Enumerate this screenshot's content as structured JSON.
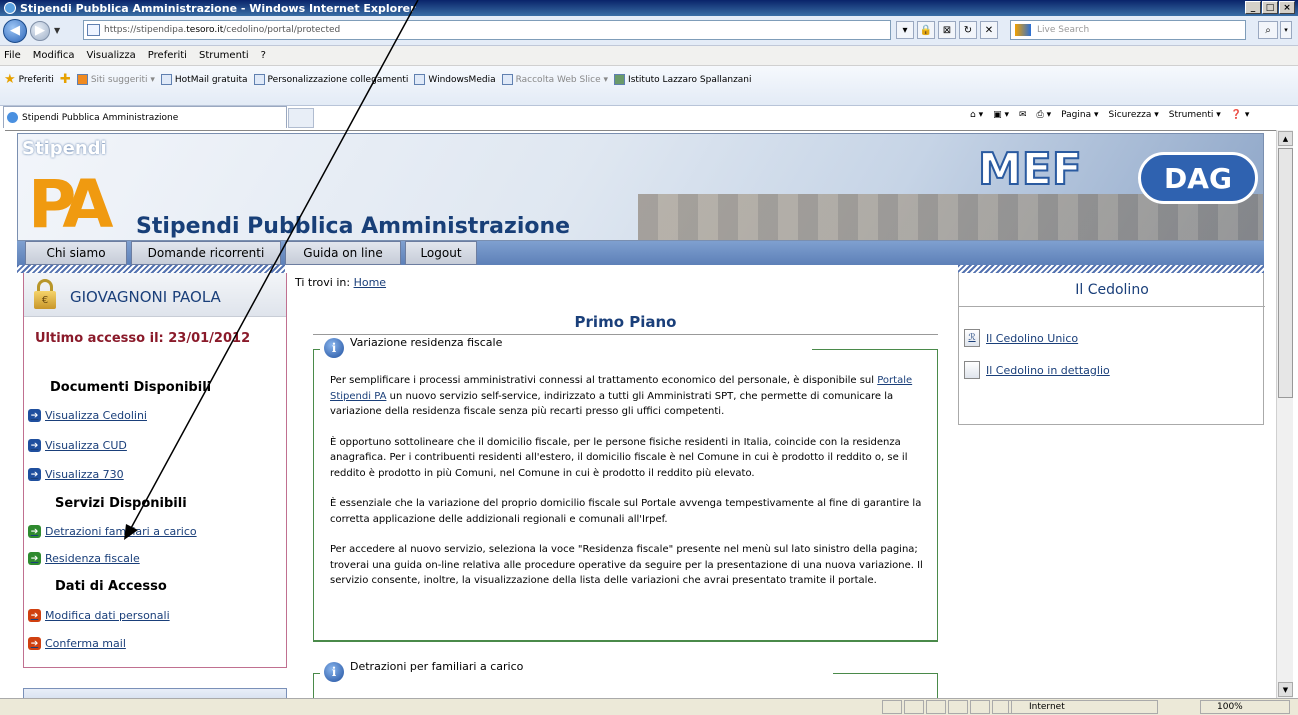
{
  "window": {
    "title": "Stipendi Pubblica Amministrazione - Windows Internet Explorer"
  },
  "address": {
    "url_prefix": "https://stipendipa.",
    "url_domain": "tesoro.it",
    "url_suffix": "/cedolino/portal/protected",
    "search_placeholder": "Live Search"
  },
  "menu": [
    "File",
    "Modifica",
    "Visualizza",
    "Preferiti",
    "Strumenti",
    "?"
  ],
  "favorites": {
    "label": "Preferiti",
    "items": [
      "Siti suggeriti ▾",
      "HotMail gratuita",
      "Personalizzazione collegamenti",
      "WindowsMedia",
      "Raccolta Web Slice ▾",
      "Istituto Lazzaro Spallanzani"
    ]
  },
  "tab": {
    "title": "Stipendi Pubblica Amministrazione"
  },
  "commandbar": [
    "Pagina ▾",
    "Sicurezza ▾",
    "Strumenti ▾"
  ],
  "banner": {
    "logo_top": "Stipendi",
    "logo_pa": "PA",
    "title": "Stipendi Pubblica Amministrazione",
    "mef": "MEF",
    "dag": "DAG"
  },
  "nav": [
    "Chi siamo",
    "Domande ricorrenti",
    "Guida on line",
    "Logout"
  ],
  "user": {
    "name": "GIOVAGNONI PAOLA",
    "last_access": "Ultimo accesso il: 23/01/2012"
  },
  "left": {
    "docs_title": "Documenti Disponibili",
    "docs": [
      "Visualizza Cedolini",
      "Visualizza CUD",
      "Visualizza 730"
    ],
    "services_title": "Servizi Disponibili",
    "services": [
      "Detrazioni familiari a carico",
      "Residenza fiscale"
    ],
    "access_title": "Dati di Accesso",
    "access": [
      "Modifica dati personali",
      "Conferma mail"
    ]
  },
  "breadcrumb": {
    "label": "Ti trovi in:",
    "home": "Home"
  },
  "center": {
    "title": "Primo Piano",
    "news1": {
      "title": "Variazione residenza fiscale",
      "p1_pre": "Per semplificare i processi amministrativi connessi al trattamento economico del personale, è disponibile sul",
      "p1_link": "Portale Stipendi PA",
      "p1_post": "un nuovo servizio self-service, indirizzato a tutti gli Amministrati SPT, che permette di comunicare la variazione della residenza fiscale senza più recarti presso gli uffici competenti.",
      "p2": "È opportuno sottolineare che il domicilio fiscale, per le persone fisiche residenti in Italia, coincide con la residenza anagrafica. Per i contribuenti residenti all'estero, il domicilio fiscale è nel Comune in cui è prodotto il reddito o, se il reddito è prodotto in più Comuni, nel Comune in cui è prodotto il reddito più elevato.",
      "p3": "È essenziale che la variazione del proprio domicilio fiscale sul Portale avvenga tempestivamente al fine di garantire la corretta applicazione delle addizionali regionali e comunali all'Irpef.",
      "p4": "Per accedere al nuovo servizio, seleziona la voce \"Residenza fiscale\" presente nel menù sul lato sinistro della pagina; troverai una guida on-line relativa alle procedure operative da seguire per la presentazione di una nuova variazione. Il servizio consente, inoltre, la visualizzazione della lista delle variazioni che avrai presentato tramite il portale."
    },
    "news2": {
      "title": "Detrazioni per familiari a carico"
    }
  },
  "right": {
    "title": "Il Cedolino",
    "links": [
      "Il Cedolino Unico",
      "Il Cedolino in dettaglio"
    ]
  },
  "status": {
    "zone": "Internet",
    "zoom": "100%"
  }
}
